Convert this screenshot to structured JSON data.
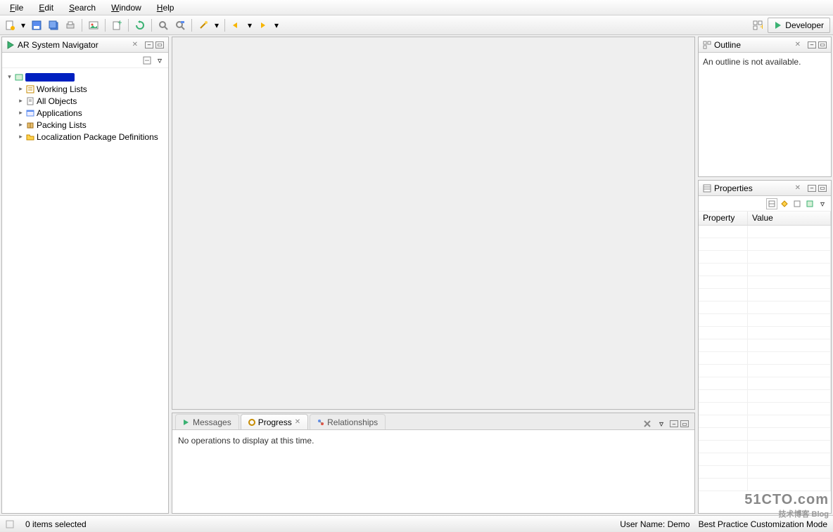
{
  "menu": {
    "file": "File",
    "edit": "Edit",
    "search": "Search",
    "window": "Window",
    "help": "Help"
  },
  "perspective": {
    "label": "Developer"
  },
  "navigator": {
    "title": "AR System Navigator",
    "items": [
      {
        "label": "Working Lists"
      },
      {
        "label": "All Objects"
      },
      {
        "label": "Applications"
      },
      {
        "label": "Packing Lists"
      },
      {
        "label": "Localization Package Definitions"
      }
    ]
  },
  "outline": {
    "title": "Outline",
    "empty": "An outline is not available."
  },
  "properties": {
    "title": "Properties",
    "col1": "Property",
    "col2": "Value"
  },
  "bottom": {
    "tabs": {
      "messages": "Messages",
      "progress": "Progress",
      "relationships": "Relationships"
    },
    "body": "No operations to display at this time."
  },
  "status": {
    "selection": "0 items selected",
    "user": "User Name: Demo",
    "mode": "Best Practice Customization Mode"
  },
  "watermark": {
    "line1": "51CTO.com",
    "line2": "技术博客  Blog"
  }
}
